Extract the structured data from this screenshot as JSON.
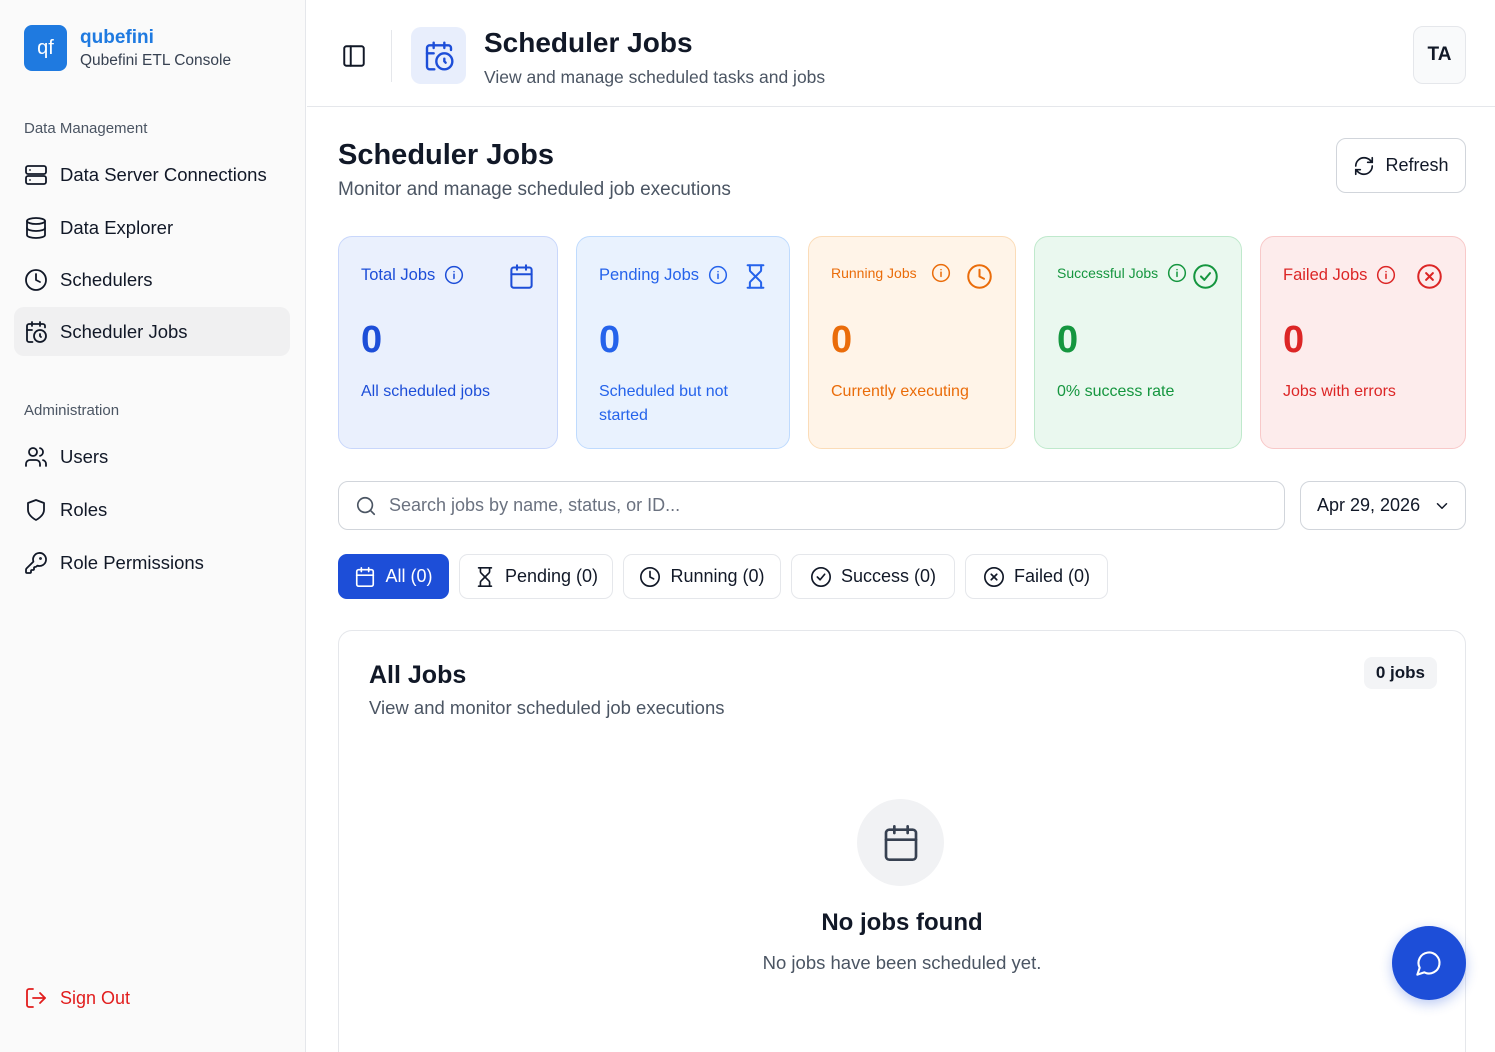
{
  "brand": {
    "logo": "qf",
    "name": "qubefini",
    "subtitle": "Qubefini ETL Console"
  },
  "sidebar": {
    "sections": [
      {
        "label": "Data Management",
        "items": [
          {
            "label": "Data Server Connections",
            "icon": "server-icon"
          },
          {
            "label": "Data Explorer",
            "icon": "database-icon"
          },
          {
            "label": "Schedulers",
            "icon": "clock-icon"
          },
          {
            "label": "Scheduler Jobs",
            "icon": "calendar-clock-icon",
            "active": true
          }
        ]
      },
      {
        "label": "Administration",
        "items": [
          {
            "label": "Users",
            "icon": "users-icon"
          },
          {
            "label": "Roles",
            "icon": "shield-icon"
          },
          {
            "label": "Role Permissions",
            "icon": "key-icon"
          }
        ]
      }
    ],
    "sign_out": "Sign Out"
  },
  "header": {
    "title": "Scheduler Jobs",
    "subtitle": "View and manage scheduled tasks and jobs",
    "avatar": "TA"
  },
  "main": {
    "title": "Scheduler Jobs",
    "subtitle": "Monitor and manage scheduled job executions",
    "refresh_label": "Refresh",
    "stats": [
      {
        "label": "Total Jobs",
        "value": "0",
        "caption": "All scheduled jobs",
        "icon": "calendar-icon"
      },
      {
        "label": "Pending Jobs",
        "value": "0",
        "caption": "Scheduled but not started",
        "icon": "hourglass-icon"
      },
      {
        "label": "Running Jobs",
        "value": "0",
        "caption": "Currently executing",
        "icon": "clock-icon"
      },
      {
        "label": "Successful Jobs",
        "value": "0",
        "caption": "0% success rate",
        "icon": "check-circle-icon"
      },
      {
        "label": "Failed Jobs",
        "value": "0",
        "caption": "Jobs with errors",
        "icon": "x-circle-icon"
      }
    ],
    "search": {
      "placeholder": "Search jobs by name, status, or ID...",
      "value": ""
    },
    "date_filter": "Apr 29, 2026",
    "filters": [
      {
        "label": "All (0)",
        "active": true
      },
      {
        "label": "Pending (0)"
      },
      {
        "label": "Running (0)"
      },
      {
        "label": "Success (0)"
      },
      {
        "label": "Failed (0)"
      }
    ],
    "jobs_panel": {
      "title": "All Jobs",
      "subtitle": "View and monitor scheduled job executions",
      "count_badge": "0 jobs",
      "empty_title": "No jobs found",
      "empty_subtitle": "No jobs have been scheduled yet."
    }
  },
  "colors": {
    "accent": "#1d4ed8",
    "brand": "#1f7ae0",
    "running": "#ea6c0a",
    "success": "#15963f",
    "failed": "#dc2626"
  }
}
